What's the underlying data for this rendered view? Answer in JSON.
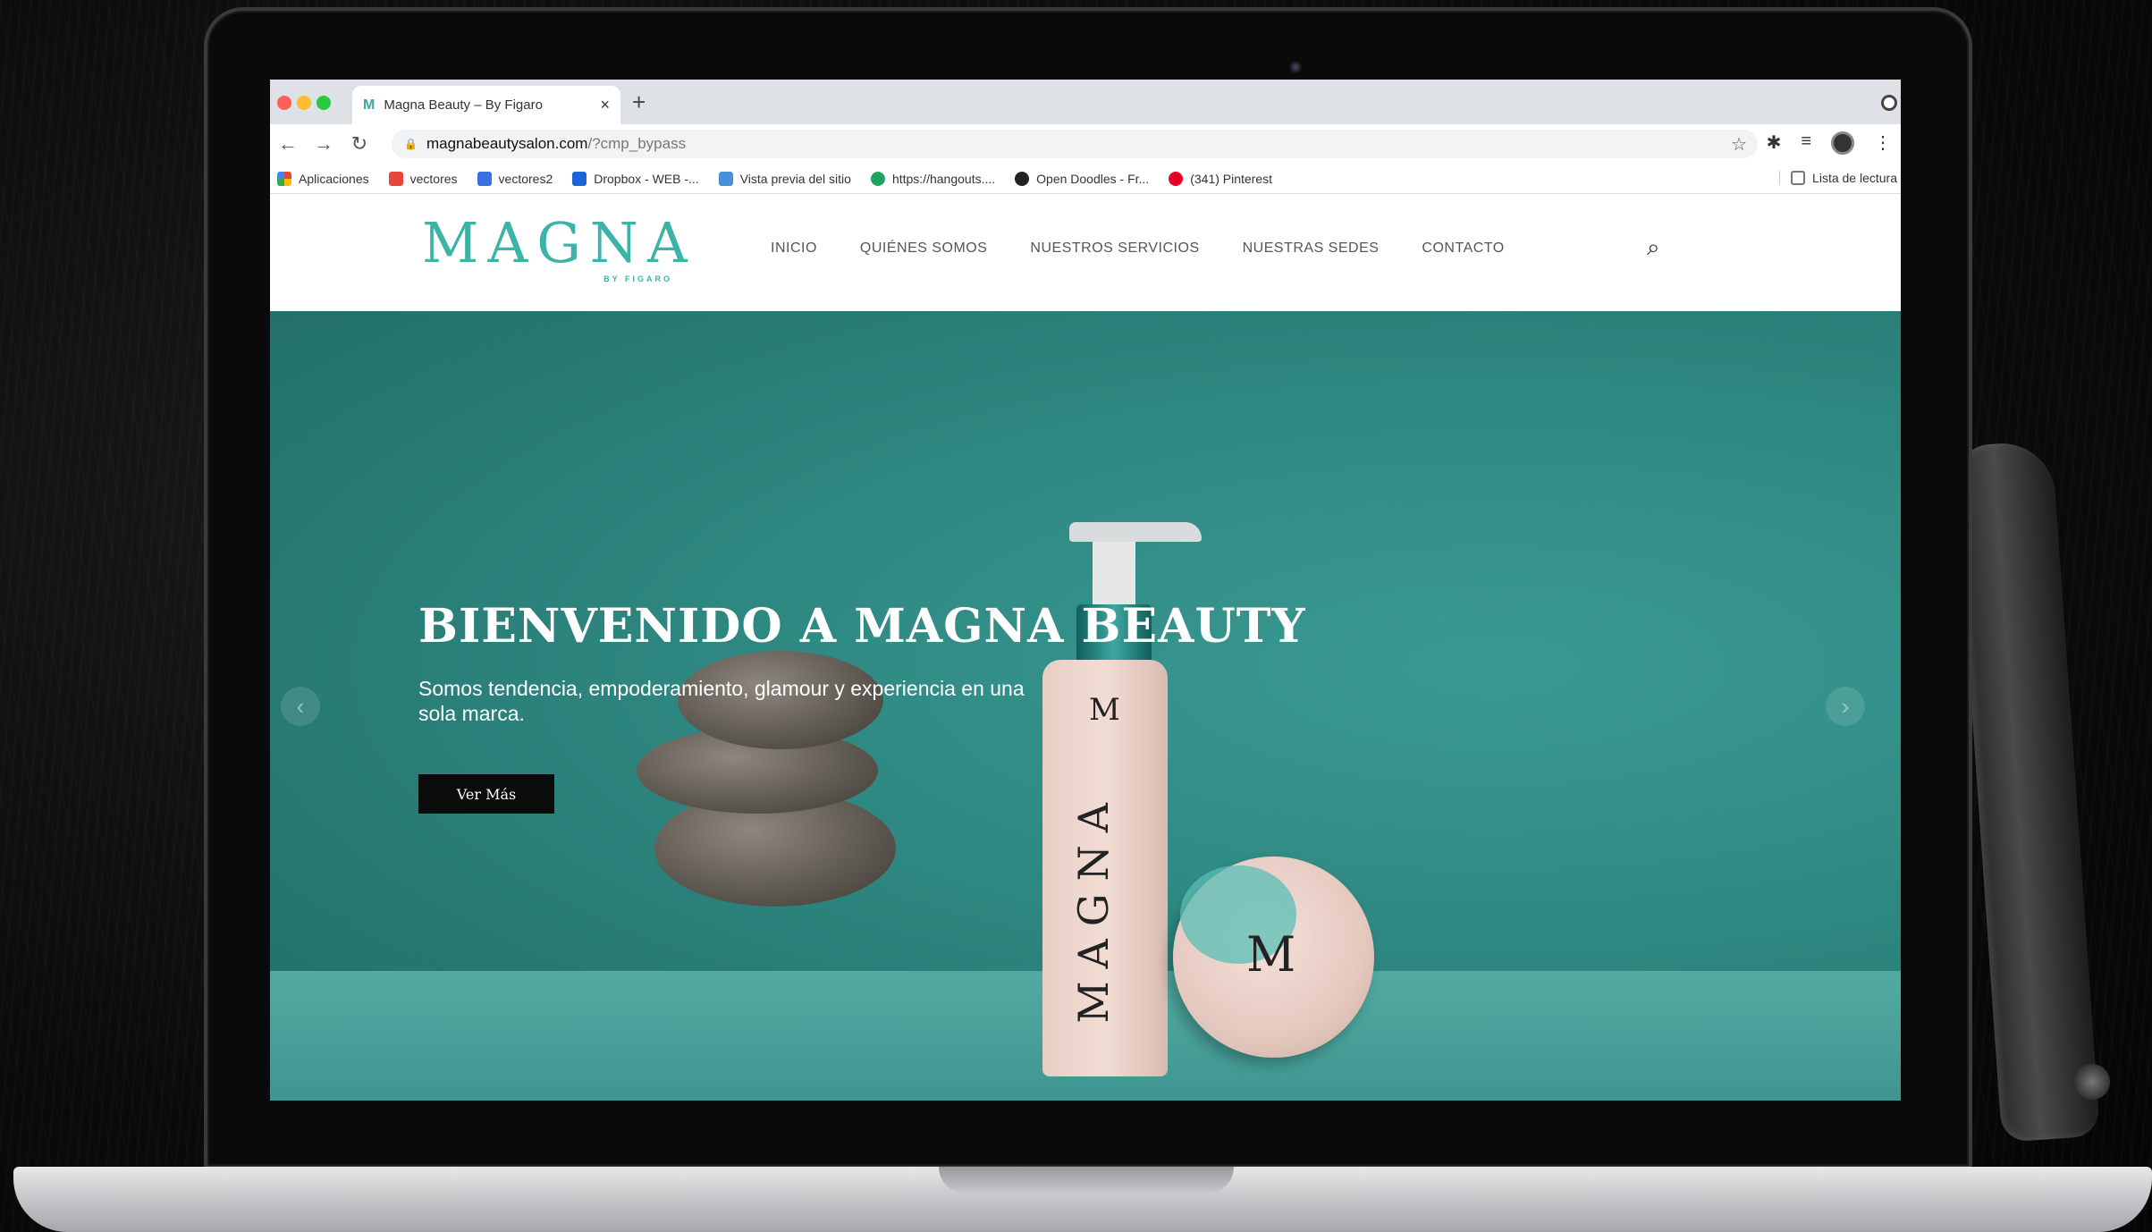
{
  "browser": {
    "tab": {
      "title": "Magna Beauty – By Figaro",
      "favicon": "M",
      "close": "×"
    },
    "new_tab": "+",
    "url_host": "magnabeautysalon.com",
    "url_path": "/?cmp_bypass",
    "bookmarks": [
      {
        "label": "Aplicaciones",
        "color": "#e8453c"
      },
      {
        "label": "vectores",
        "color": "#e8453c"
      },
      {
        "label": "vectores2",
        "color": "#3b6fe0"
      },
      {
        "label": "Dropbox - WEB -...",
        "color": "#1e63d6"
      },
      {
        "label": "Vista previa del sitio",
        "color": "#4a90d9"
      },
      {
        "label": "https://hangouts....",
        "color": "#1fa463"
      },
      {
        "label": "Open Doodles - Fr...",
        "color": "#222222"
      },
      {
        "label": "(341) Pinterest",
        "color": "#e60023"
      }
    ],
    "reading_list": "Lista de lectura"
  },
  "site": {
    "logo": "MAGNA",
    "logo_sub": "BY FIGARO",
    "menu": [
      "INICIO",
      "QUIÉNES SOMOS",
      "NUESTROS SERVICIOS",
      "NUESTRAS SEDES",
      "CONTACTO"
    ]
  },
  "hero": {
    "title": "BIENVENIDO A MAGNA BEAUTY",
    "subtitle": "Somos tendencia, empoderamiento, glamour y experiencia en una sola marca.",
    "button": "Ver Más",
    "prev_arrow": "‹",
    "next_arrow": "›"
  },
  "product": {
    "bottle_mark": "M",
    "bottle_word": "MAGNA",
    "jar_mark": "M"
  },
  "colors": {
    "brand_teal": "#3cb3a7",
    "hero_bg": "#2f8a83",
    "button_bg": "#0b0b0b"
  }
}
